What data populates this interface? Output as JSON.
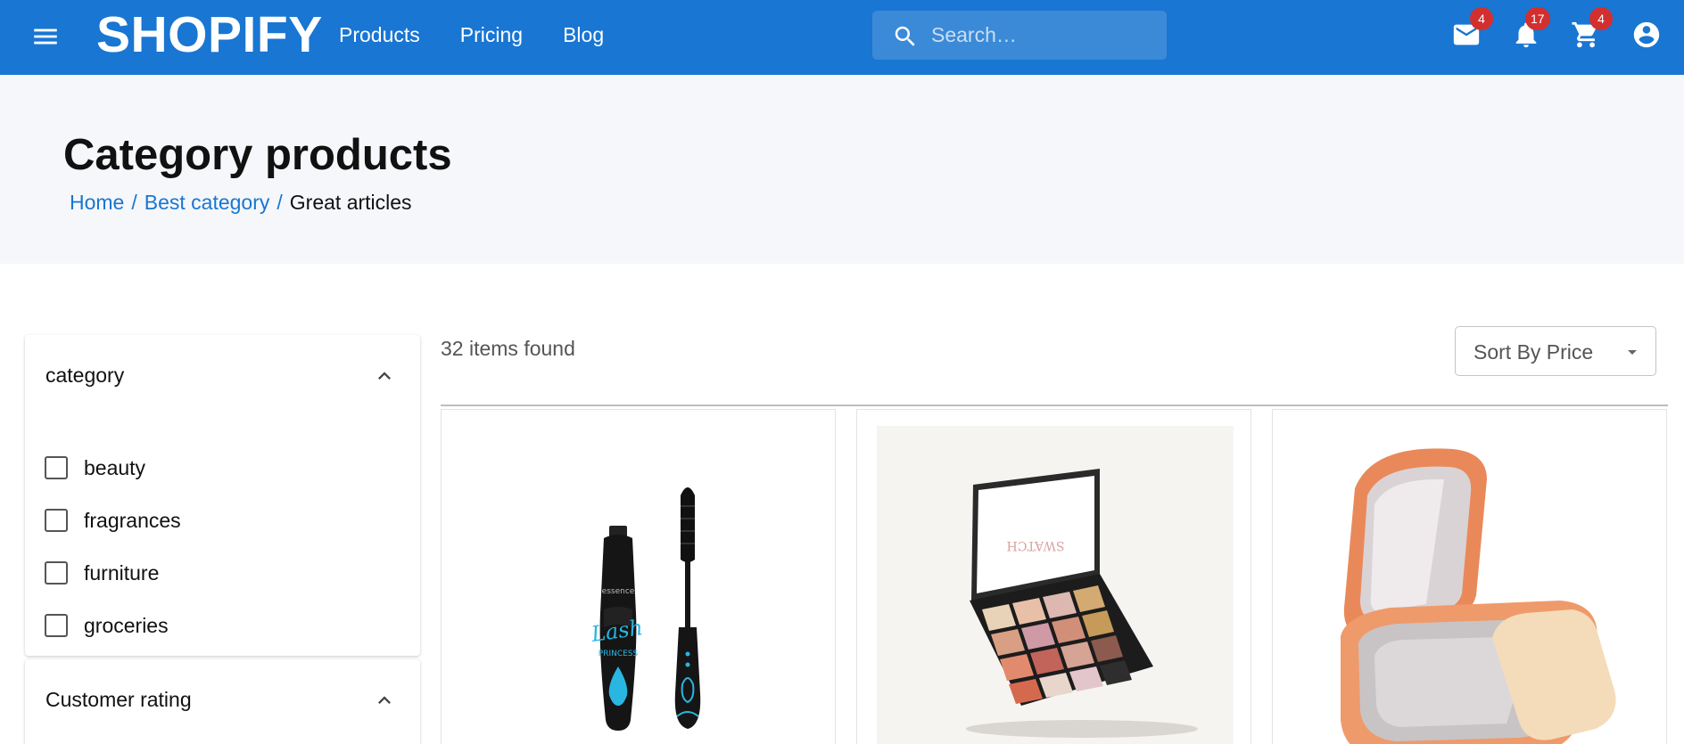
{
  "appbar": {
    "brand": "SHOPIFY",
    "nav": [
      "Products",
      "Pricing",
      "Blog"
    ],
    "search_placeholder": "Search…",
    "mail_badge": "4",
    "notifications_badge": "17",
    "cart_badge": "4",
    "bar_color": "#1976d2",
    "badge_color": "#d32f2f"
  },
  "header": {
    "title": "Category products",
    "breadcrumb": [
      "Home",
      "Best category",
      "Great articles"
    ]
  },
  "filters": {
    "category_title": "category",
    "categories": [
      "beauty",
      "fragrances",
      "furniture",
      "groceries"
    ],
    "rating_title": "Customer rating"
  },
  "results": {
    "count_text": "32 items found",
    "sort_label": "Sort By Price",
    "products": [
      {
        "image": "mascara-image"
      },
      {
        "image": "eyeshadow-palette-image"
      },
      {
        "image": "compact-powder-image"
      }
    ]
  }
}
